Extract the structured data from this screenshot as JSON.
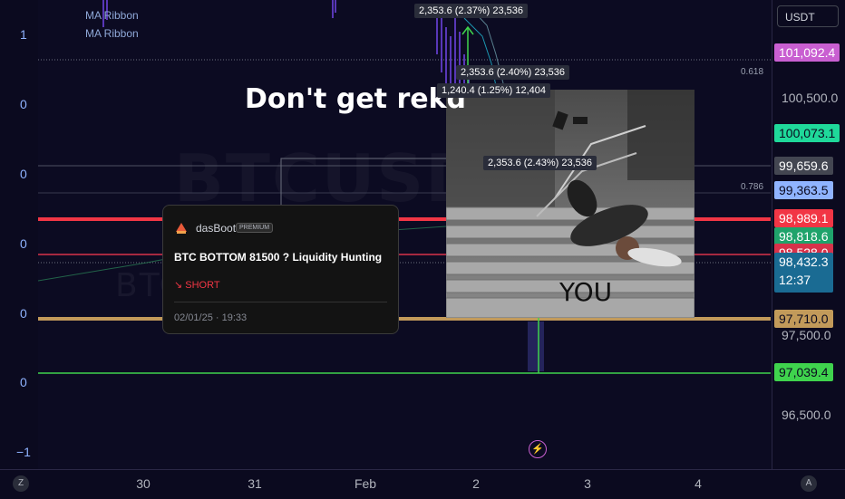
{
  "top_right": {
    "currency_button": "USDT"
  },
  "legend": [
    "MA Ribbon",
    "MA Ribbon"
  ],
  "left_axis_ticks": [
    "1",
    "0",
    "0",
    "0",
    "0",
    "0",
    "−1"
  ],
  "bottom_axis": {
    "left_icon": "Z",
    "right_icon": "A",
    "ticks": [
      "30",
      "31",
      "Feb",
      "2",
      "3",
      "4"
    ]
  },
  "price_scale": {
    "plain": [
      "100,500.0",
      "97,500.0",
      "96,500.0"
    ],
    "tags": [
      {
        "label": "101,092.4",
        "bg": "#c95fd1",
        "fg": "#ffffff"
      },
      {
        "label": "100,073.1",
        "bg": "#1fd99a",
        "fg": "#0b0a1f"
      },
      {
        "label": "99,659.6",
        "bg": "#434651",
        "fg": "#ffffff"
      },
      {
        "label": "99,363.5",
        "bg": "#8fb3ff",
        "fg": "#0b0a1f"
      },
      {
        "label": "98,989.1",
        "bg": "#f23645",
        "fg": "#ffffff"
      },
      {
        "label": "98,818.6",
        "bg": "#1fa36b",
        "fg": "#ffffff"
      },
      {
        "label": "98,528.0",
        "bg": "#d8324a",
        "fg": "#ffffff"
      },
      {
        "label": "98,432.3",
        "bg": "#1a6b93",
        "fg": "#ffffff",
        "sub": "12:37"
      },
      {
        "label": "97,710.0",
        "bg": "#c29a5a",
        "fg": "#0b0a1f"
      },
      {
        "label": "97,039.4",
        "bg": "#3fd34d",
        "fg": "#0b0a1f"
      }
    ]
  },
  "fib_labels": [
    "0.618",
    "0.786"
  ],
  "overlay": {
    "title": "Don't get rekd",
    "meme_caption": "YOU"
  },
  "measurements": [
    "2,353.6 (2.37%) 23,536",
    "2,353.6 (2.40%) 23,536",
    "1,240.4 (1.25%) 12,404",
    "2,353.6 (2.43%) 23,536"
  ],
  "idea_card": {
    "author": "dasBoot",
    "badge": "PREMIUM",
    "title": "BTC BOTTOM 81500 ?  Liquidity Hunting",
    "direction": "↘ SHORT",
    "date": "02/01/25 · 19:33"
  },
  "watermark": {
    "symbol": "BTCUSD",
    "sub": "BTCUSD PERPE"
  },
  "colors": {
    "red_line": "#f23645",
    "gold_line": "#c29a5a",
    "green_line": "#3fd34d"
  }
}
